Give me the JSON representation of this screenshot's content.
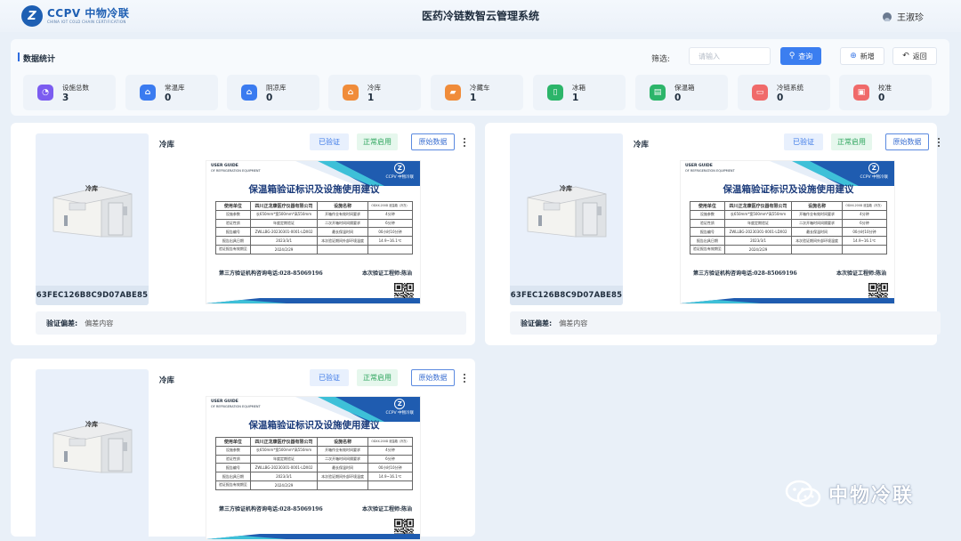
{
  "header": {
    "logo_mark": "Z",
    "logo_name": "CCPV 中物冷联",
    "logo_sub": "CHINA IOT COLD CHAIN CERTIFICATION",
    "title": "医药冷链数智云管理系统",
    "user_name": "王淑珍"
  },
  "toolbar": {
    "section_title": "数据统计",
    "filter_label": "筛选:",
    "search_placeholder": "请输入",
    "query_label": "查询",
    "add_label": "新增",
    "back_label": "返回"
  },
  "stats": [
    {
      "label": "设施总数",
      "value": "3",
      "color": "#7b5cf0",
      "icon": "pie-chart-icon",
      "glyph": "◔"
    },
    {
      "label": "常温库",
      "value": "0",
      "color": "#3a7bf0",
      "icon": "warehouse-icon",
      "glyph": "⌂"
    },
    {
      "label": "阴凉库",
      "value": "0",
      "color": "#3a7bf0",
      "icon": "warehouse-icon",
      "glyph": "⌂"
    },
    {
      "label": "冷库",
      "value": "1",
      "color": "#f08c3a",
      "icon": "warehouse-icon",
      "glyph": "⌂"
    },
    {
      "label": "冷藏车",
      "value": "1",
      "color": "#f08c3a",
      "icon": "truck-icon",
      "glyph": "▰"
    },
    {
      "label": "冰箱",
      "value": "1",
      "color": "#2cb56a",
      "icon": "fridge-icon",
      "glyph": "▯"
    },
    {
      "label": "保温箱",
      "value": "0",
      "color": "#2cb56a",
      "icon": "box-icon",
      "glyph": "▤"
    },
    {
      "label": "冷链系统",
      "value": "0",
      "color": "#f06a6a",
      "icon": "monitor-icon",
      "glyph": "▭"
    },
    {
      "label": "校准",
      "value": "0",
      "color": "#f06a6a",
      "icon": "calibration-icon",
      "glyph": "▣"
    }
  ],
  "cards": [
    {
      "title": "冷库",
      "room_label": "冷库",
      "device_id": "63FEC126B8C9D07ABE85",
      "tag_verified": "已验证",
      "tag_active": "正常启用",
      "raw_data_label": "原始数据",
      "deviation_label": "验证偏差:",
      "deviation_value": "偏差内容",
      "doc_guide": "USER GUIDE",
      "doc_guide2": "OF REFRIGERATION EQUIPMENT",
      "doc_logo": "CCPV 中物冷联",
      "doc_title": "保温箱验证标识及设施使用建议",
      "doc_rows": [
        [
          "使用单位",
          "四川正龙康医疗仪器有限公司",
          "设施名称",
          "ODXX-200D 液温箱（冷冻）"
        ],
        [
          "设施参数",
          "长650mm*宽500mm*高550mm",
          "开箱作业有效时间要求",
          "4分钟"
        ],
        [
          "验证性质",
          "年度定期验证",
          "二次开箱时间间隔要求",
          "6分钟"
        ],
        [
          "报告编号",
          "ZWLLBG-20230301-0001-LDX02",
          "最长保温时间",
          "00小时10分钟"
        ],
        [
          "报告出具日期",
          "2023/3/1",
          "本次验证期间外部环境温度",
          "14.9~16.1℃"
        ],
        [
          "验证报告有效期至",
          "2024/2/29",
          "",
          ""
        ]
      ],
      "doc_phone": "第三方验证机构咨询电话:028-85069196",
      "doc_engineer": "本次验证工程师:陈治"
    },
    {
      "title": "冷库",
      "room_label": "冷库",
      "device_id": "63FEC126B8C9D07ABE85",
      "tag_verified": "已验证",
      "tag_active": "正常启用",
      "raw_data_label": "原始数据",
      "deviation_label": "验证偏差:",
      "deviation_value": "偏差内容",
      "doc_guide": "USER GUIDE",
      "doc_guide2": "OF REFRIGERATION EQUIPMENT",
      "doc_logo": "CCPV 中物冷联",
      "doc_title": "保温箱验证标识及设施使用建议",
      "doc_rows": [
        [
          "使用单位",
          "四川正龙康医疗仪器有限公司",
          "设施名称",
          "ODXX-200D 液温箱（冷冻）"
        ],
        [
          "设施参数",
          "长650mm*宽500mm*高550mm",
          "开箱作业有效时间要求",
          "4分钟"
        ],
        [
          "验证性质",
          "年度定期验证",
          "二次开箱时间间隔要求",
          "6分钟"
        ],
        [
          "报告编号",
          "ZWLLBG-20230301-0001-LDX02",
          "最长保温时间",
          "00小时10分钟"
        ],
        [
          "报告出具日期",
          "2023/3/1",
          "本次验证期间外部环境温度",
          "14.9~16.1℃"
        ],
        [
          "验证报告有效期至",
          "2024/2/29",
          "",
          ""
        ]
      ],
      "doc_phone": "第三方验证机构咨询电话:028-85069196",
      "doc_engineer": "本次验证工程师:陈治"
    },
    {
      "title": "冷库",
      "room_label": "冷库",
      "device_id": "",
      "tag_verified": "已验证",
      "tag_active": "正常启用",
      "raw_data_label": "原始数据",
      "deviation_label": "",
      "deviation_value": "",
      "doc_guide": "USER GUIDE",
      "doc_guide2": "OF REFRIGERATION EQUIPMENT",
      "doc_logo": "CCPV 中物冷联",
      "doc_title": "保温箱验证标识及设施使用建议",
      "doc_rows": [
        [
          "使用单位",
          "四川正龙康医疗仪器有限公司",
          "设施名称",
          "ODXX-200D 液温箱（冷冻）"
        ],
        [
          "设施参数",
          "长650mm*宽500mm*高550mm",
          "开箱作业有效时间要求",
          "4分钟"
        ],
        [
          "验证性质",
          "年度定期验证",
          "二次开箱时间间隔要求",
          "6分钟"
        ],
        [
          "报告编号",
          "ZWLLBG-20230301-0001-LDX02",
          "最长保温时间",
          "00小时10分钟"
        ],
        [
          "报告出具日期",
          "2023/3/1",
          "本次验证期间外部环境温度",
          "14.9~16.1℃"
        ],
        [
          "验证报告有效期至",
          "2024/2/29",
          "",
          ""
        ]
      ],
      "doc_phone": "第三方验证机构咨询电话:028-85069196",
      "doc_engineer": "本次验证工程师:陈治"
    }
  ],
  "watermark": {
    "text": "中物冷联"
  }
}
